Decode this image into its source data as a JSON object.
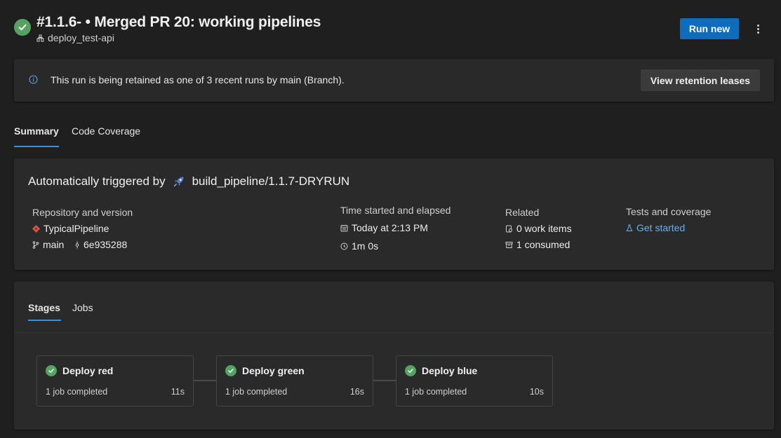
{
  "header": {
    "title": "#1.1.6- • Merged PR 20: working pipelines",
    "pipeline_name": "deploy_test-api",
    "run_new_label": "Run new"
  },
  "banner": {
    "text": "This run is being retained as one of 3 recent runs by main (Branch).",
    "button_label": "View retention leases"
  },
  "tabs": [
    {
      "label": "Summary",
      "active": true
    },
    {
      "label": "Code Coverage",
      "active": false
    }
  ],
  "summary": {
    "trigger_prefix": "Automatically triggered by",
    "trigger_source": "build_pipeline/1.1.7-DRYRUN",
    "repo": {
      "label": "Repository and version",
      "name": "TypicalPipeline",
      "branch": "main",
      "commit": "6e935288"
    },
    "time": {
      "label": "Time started and elapsed",
      "started": "Today at 2:13 PM",
      "elapsed": "1m 0s"
    },
    "related": {
      "label": "Related",
      "work_items": "0 work items",
      "consumed": "1 consumed"
    },
    "tests": {
      "label": "Tests and coverage",
      "link": "Get started"
    }
  },
  "stages_tabs": [
    {
      "label": "Stages",
      "active": true
    },
    {
      "label": "Jobs",
      "active": false
    }
  ],
  "stages": [
    {
      "name": "Deploy red",
      "status": "1 job completed",
      "duration": "11s"
    },
    {
      "name": "Deploy green",
      "status": "1 job completed",
      "duration": "16s"
    },
    {
      "name": "Deploy blue",
      "status": "1 job completed",
      "duration": "10s"
    }
  ],
  "colors": {
    "success": "#54a362",
    "primary": "#0f6cbd",
    "link": "#6aaef0",
    "background": "#1f1f1f"
  }
}
